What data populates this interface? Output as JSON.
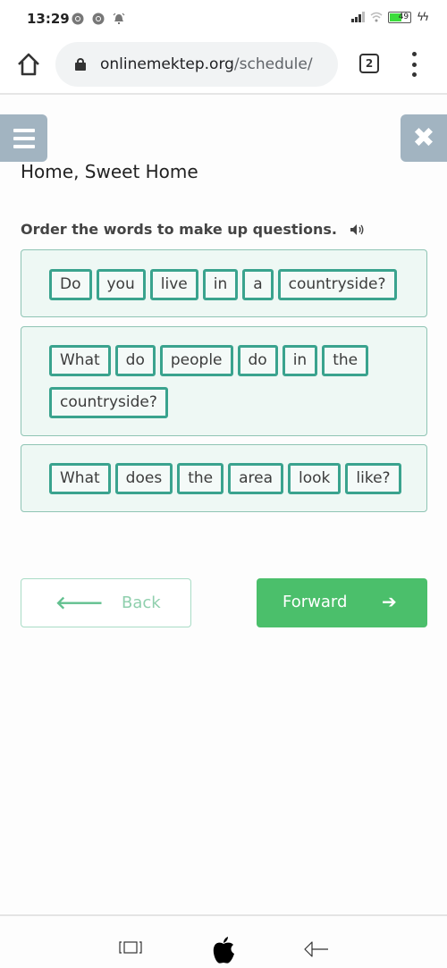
{
  "status_bar": {
    "time": "13:29",
    "notification_icons": [
      "chrome-icon",
      "chrome-icon",
      "alarm-icon"
    ],
    "battery_level": "49",
    "signal_icon": "signal-icon",
    "wifi_icon": "wifi-icon",
    "charging_icon": "bolt-icon"
  },
  "browser": {
    "url_host": "onlinemektep.org",
    "url_path": "/schedule/",
    "tab_count": "2"
  },
  "page": {
    "title": "Home, Sweet Home",
    "instruction": "Order the words to make up questions."
  },
  "exercises": [
    {
      "words": [
        "Do",
        "you",
        "live",
        "in",
        "a",
        "countryside?"
      ]
    },
    {
      "words": [
        "What",
        "do",
        "people",
        "do",
        "in",
        "the",
        "countryside?"
      ]
    },
    {
      "words": [
        "What",
        "does",
        "the",
        "area",
        "look",
        "like?"
      ]
    }
  ],
  "navigation": {
    "back_label": "Back",
    "back_arrow": "🡐",
    "forward_label": "Forward",
    "forward_arrow": "➔"
  },
  "colors": {
    "accent_green": "#4bbf6b",
    "word_border": "#3aa38e",
    "card_bg": "#eef8f4",
    "header_button": "#a2b4c1"
  }
}
